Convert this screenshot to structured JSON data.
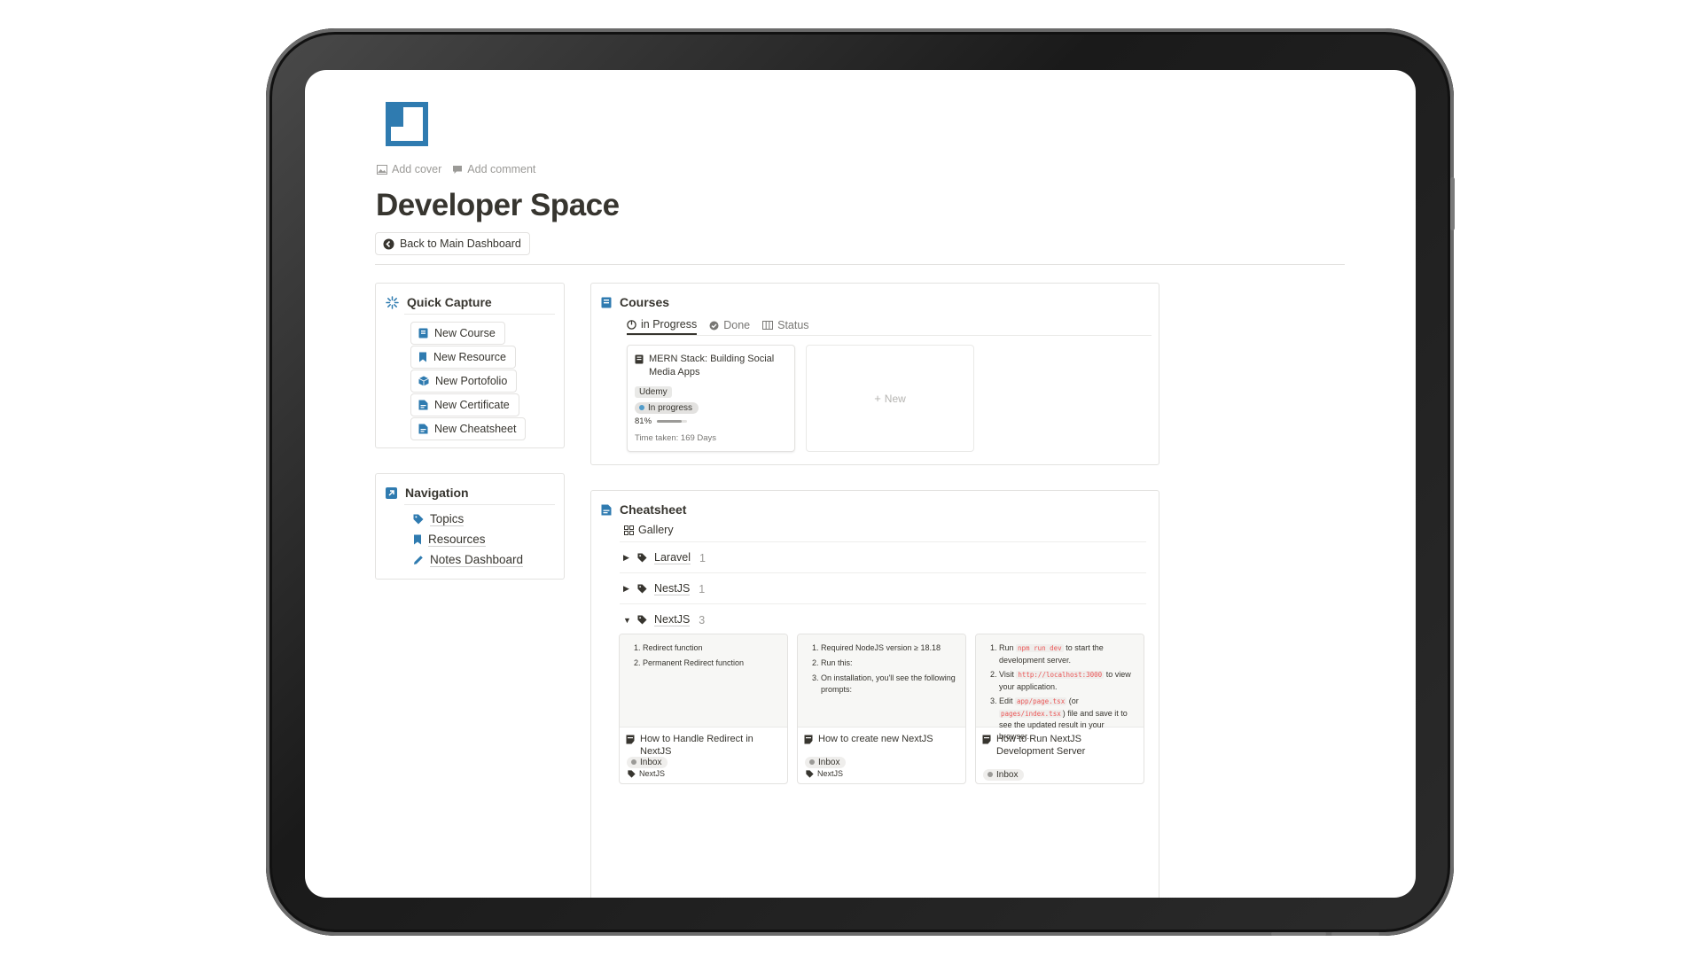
{
  "page": {
    "add_cover": "Add cover",
    "add_comment": "Add comment",
    "title": "Developer Space",
    "back_button": "Back to Main Dashboard"
  },
  "quick_capture": {
    "title": "Quick Capture",
    "buttons": [
      "New Course",
      "New Resource",
      "New Portofolio",
      "New Certificate",
      "New Cheatsheet"
    ]
  },
  "navigation": {
    "title": "Navigation",
    "items": [
      "Topics",
      "Resources",
      "Notes Dashboard"
    ]
  },
  "courses": {
    "title": "Courses",
    "tabs": [
      "in Progress",
      "Done",
      "Status"
    ],
    "cards": [
      {
        "title": "MERN Stack: Building Social Media Apps",
        "tag": "Udemy",
        "status": "In progress",
        "progress_label": "81%",
        "progress": 0.81,
        "time_taken": "Time taken: 169 Days"
      }
    ],
    "new_label": "New"
  },
  "cheatsheet": {
    "title": "Cheatsheet",
    "view": "Gallery",
    "groups": [
      {
        "name": "Laravel",
        "count": "1",
        "expanded": false
      },
      {
        "name": "NestJS",
        "count": "1",
        "expanded": false
      },
      {
        "name": "NextJS",
        "count": "3",
        "expanded": true
      }
    ],
    "cards": [
      {
        "items": [
          "Redirect function",
          "Permanent Redirect function"
        ],
        "title": "How to Handle Redirect in NextJS",
        "status": "Inbox",
        "tag": "NextJS"
      },
      {
        "items": [
          "Required NodeJS version ≥ 18.18",
          "Run this:",
          "On installation, you'll see the following prompts:"
        ],
        "title": "How to create new NextJS",
        "status": "Inbox",
        "tag": "NextJS"
      },
      {
        "item1_a": "Run",
        "item1_code": "npm run dev",
        "item1_b": "to start the development server.",
        "item2_a": "Visit",
        "item2_code": "http://localhost:3000",
        "item2_b": "to view your application.",
        "item3_a": "Edit",
        "item3_code1": "app/page.tsx",
        "item3_mid": "(or",
        "item3_code2": "pages/index.tsx",
        "item3_b": ") file and save it to see the updated result in your browser.",
        "title": "How to Run NextJS Development Server",
        "status": "Inbox"
      }
    ]
  },
  "colors": {
    "accent": "#2f7bb0",
    "text": "#37352f",
    "muted": "#9b9a97",
    "border": "#e3e2e0",
    "status_blue": "#529cca",
    "status_gray": "#9b9a97",
    "code_red": "#eb5757"
  },
  "icons": {
    "page_icon": "layout-icon",
    "quick_capture": "sparkle-icon",
    "navigation": "arrow-up-right-icon",
    "courses": "book-icon",
    "cheatsheet": "doc-icon"
  }
}
